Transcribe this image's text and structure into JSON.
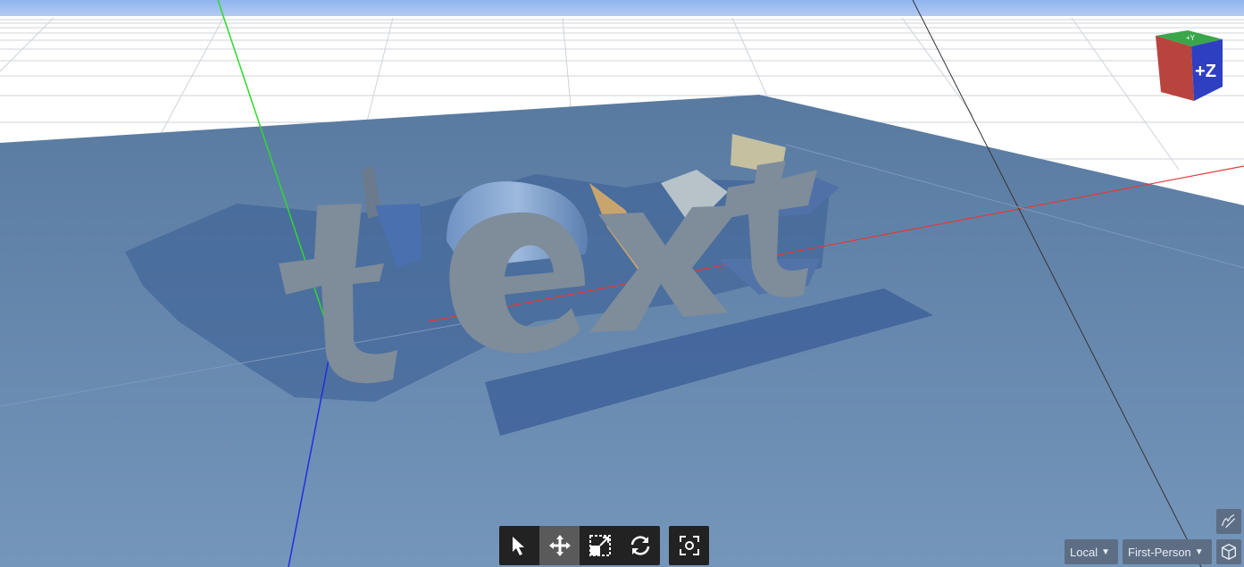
{
  "scene": {
    "model_text": "text",
    "colors": {
      "sky": "#8fb4f0",
      "ground": "#ffffff",
      "plane": "#5c7ea3",
      "text_face": "#7f8c9a",
      "axis_x": "#e23a3a",
      "axis_y": "#2fd82f",
      "axis_z": "#1e2fe0"
    }
  },
  "nav_cube": {
    "front_label": "+Z",
    "top_label": "+Y"
  },
  "toolbar": {
    "tools": [
      {
        "name": "select-tool",
        "icon": "arrow-cursor-icon",
        "active": false
      },
      {
        "name": "move-tool",
        "icon": "move-arrows-icon",
        "active": true
      },
      {
        "name": "scale-tool",
        "icon": "scale-box-icon",
        "active": false
      },
      {
        "name": "rotate-tool",
        "icon": "rotate-arrows-icon",
        "active": false
      }
    ],
    "focus_icon": "focus-target-icon"
  },
  "space_select": {
    "value": "Local"
  },
  "camera_select": {
    "value": "First-Person"
  },
  "side_icons": [
    "sketch-icon",
    "3d-view-icon"
  ]
}
